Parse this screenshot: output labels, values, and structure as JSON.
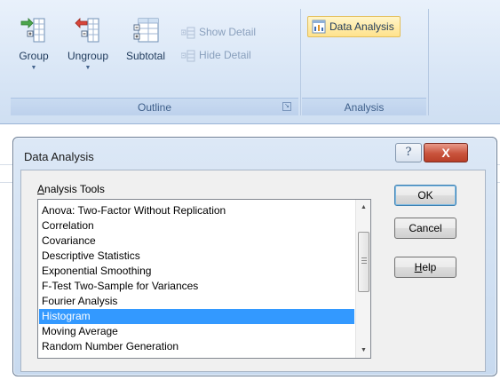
{
  "ribbon": {
    "outline_group": {
      "group_button": "Group",
      "ungroup_button": "Ungroup",
      "subtotal_button": "Subtotal",
      "show_detail": "Show Detail",
      "hide_detail": "Hide Detail",
      "label": "Outline"
    },
    "analysis_group": {
      "data_analysis_button": "Data Analysis",
      "label": "Analysis"
    }
  },
  "dialog": {
    "title": "Data Analysis",
    "help_glyph": "?",
    "close_glyph": "X",
    "tools_label_access": "A",
    "tools_label_rest": "nalysis Tools",
    "items": [
      "Anova: Two-Factor Without Replication",
      "Correlation",
      "Covariance",
      "Descriptive Statistics",
      "Exponential Smoothing",
      "F-Test Two-Sample for Variances",
      "Fourier Analysis",
      "Histogram",
      "Moving Average",
      "Random Number Generation"
    ],
    "selected_item": "Histogram",
    "ok_label": "OK",
    "cancel_label": "Cancel",
    "help_access": "H",
    "help_rest": "elp"
  },
  "colors": {
    "selection": "#3399ff",
    "close_button": "#c9533c",
    "data_analysis_highlight": "#ffe28c"
  }
}
